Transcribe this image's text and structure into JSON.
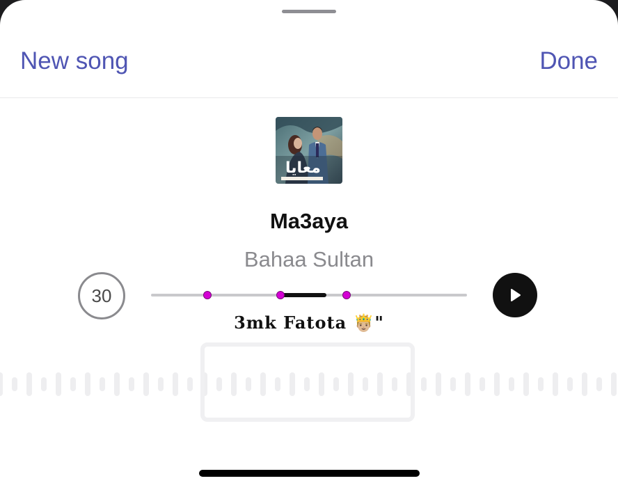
{
  "header": {
    "left_label": "New song",
    "right_label": "Done"
  },
  "song": {
    "title": "Ma3aya",
    "artist": "Bahaa Sultan",
    "album_art_text": "معايا"
  },
  "controls": {
    "duration_label": "30",
    "selection_start_fraction": 0.41,
    "selection_end_fraction": 0.555,
    "marker_fractions": [
      0.178,
      0.41,
      0.62
    ],
    "lyric": "3mk Fatota 🤴🏼\""
  },
  "colors": {
    "accent": "#4f55b3",
    "marker": "#d400d4",
    "waveform_bar": "#eeeef0"
  },
  "icons": {
    "play": "play-icon"
  }
}
